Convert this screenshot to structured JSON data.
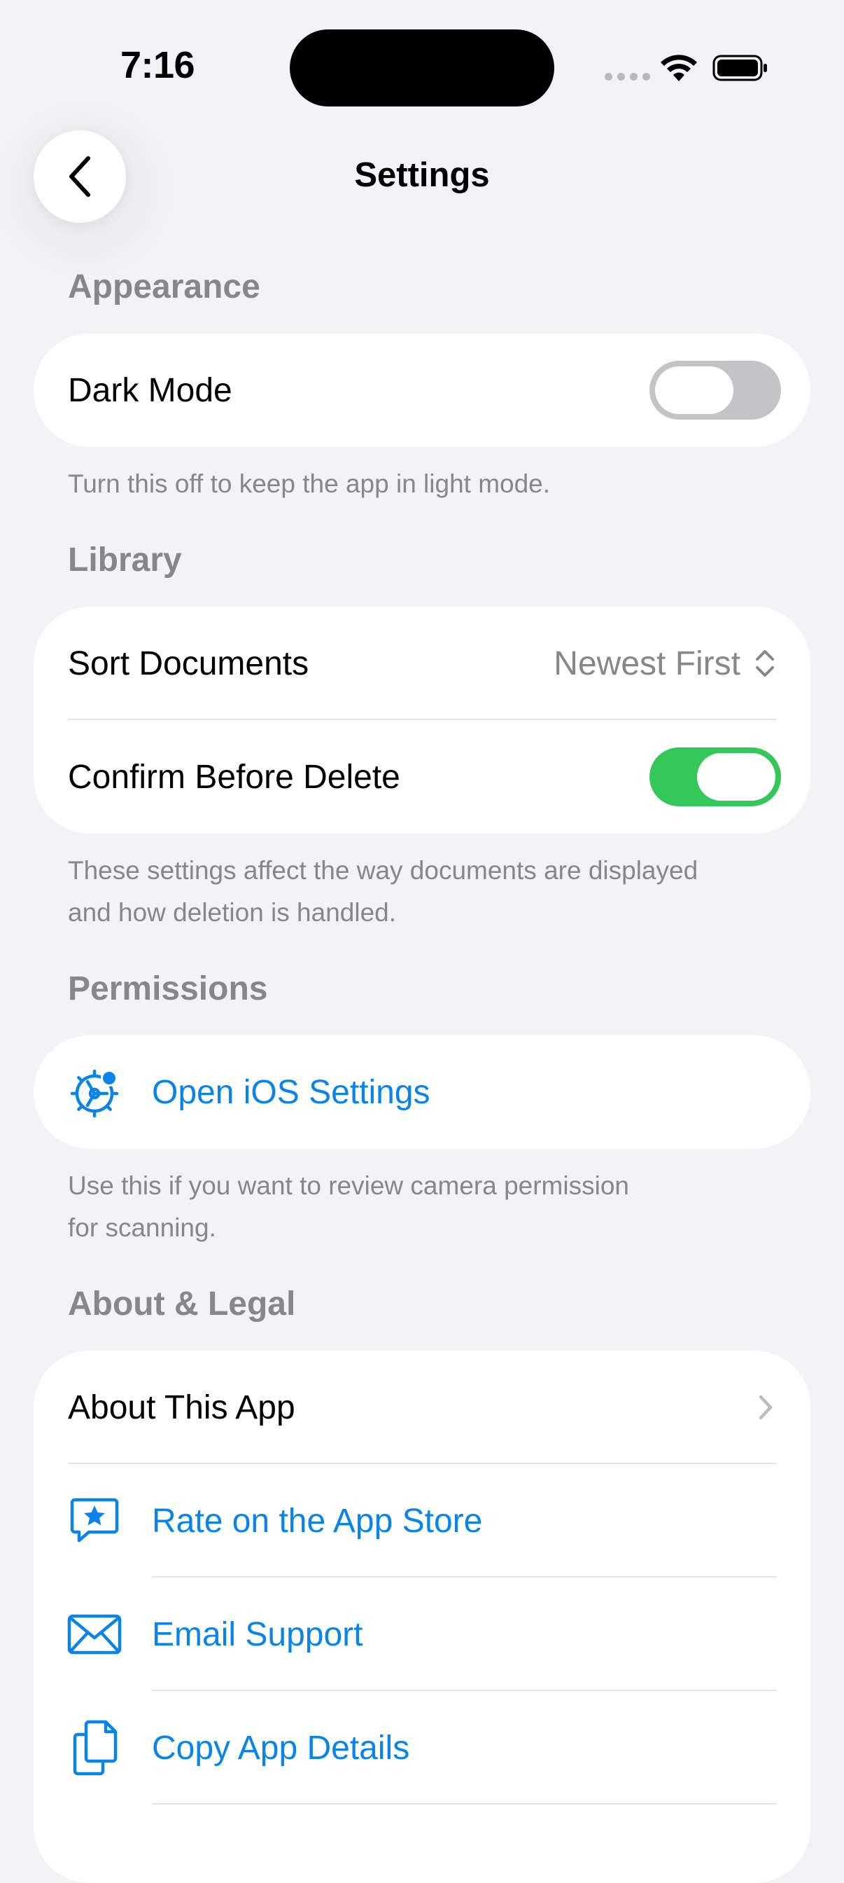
{
  "status_bar": {
    "time": "7:16"
  },
  "nav": {
    "title": "Settings"
  },
  "sections": {
    "appearance": {
      "header": "Appearance",
      "dark_mode": {
        "label": "Dark Mode",
        "value": false
      },
      "footer": "Turn this off to keep the app in light mode."
    },
    "library": {
      "header": "Library",
      "sort": {
        "label": "Sort Documents",
        "value": "Newest First"
      },
      "confirm_delete": {
        "label": "Confirm Before Delete",
        "value": true
      },
      "footer_line1": "These settings affect the way documents are displayed",
      "footer_line2": "and how deletion is handled."
    },
    "permissions": {
      "header": "Permissions",
      "open_settings": {
        "label": "Open iOS Settings",
        "icon": "gear-badge-icon"
      },
      "footer_line1": "Use this if you want to review camera permission",
      "footer_line2": "for scanning."
    },
    "about": {
      "header": "About & Legal",
      "items": [
        {
          "label": "About This App",
          "icon": "chevron-right-icon"
        },
        {
          "label": "Rate on the App Store",
          "icon": "star-bubble-icon"
        },
        {
          "label": "Email Support",
          "icon": "envelope-icon"
        },
        {
          "label": "Copy App Details",
          "icon": "documents-icon"
        }
      ]
    }
  },
  "colors": {
    "background": "#f2f2f7",
    "accent": "#0a84e8",
    "toggle_on": "#34c759",
    "toggle_off": "#c4c4c8",
    "secondary_text": "#86868b"
  }
}
